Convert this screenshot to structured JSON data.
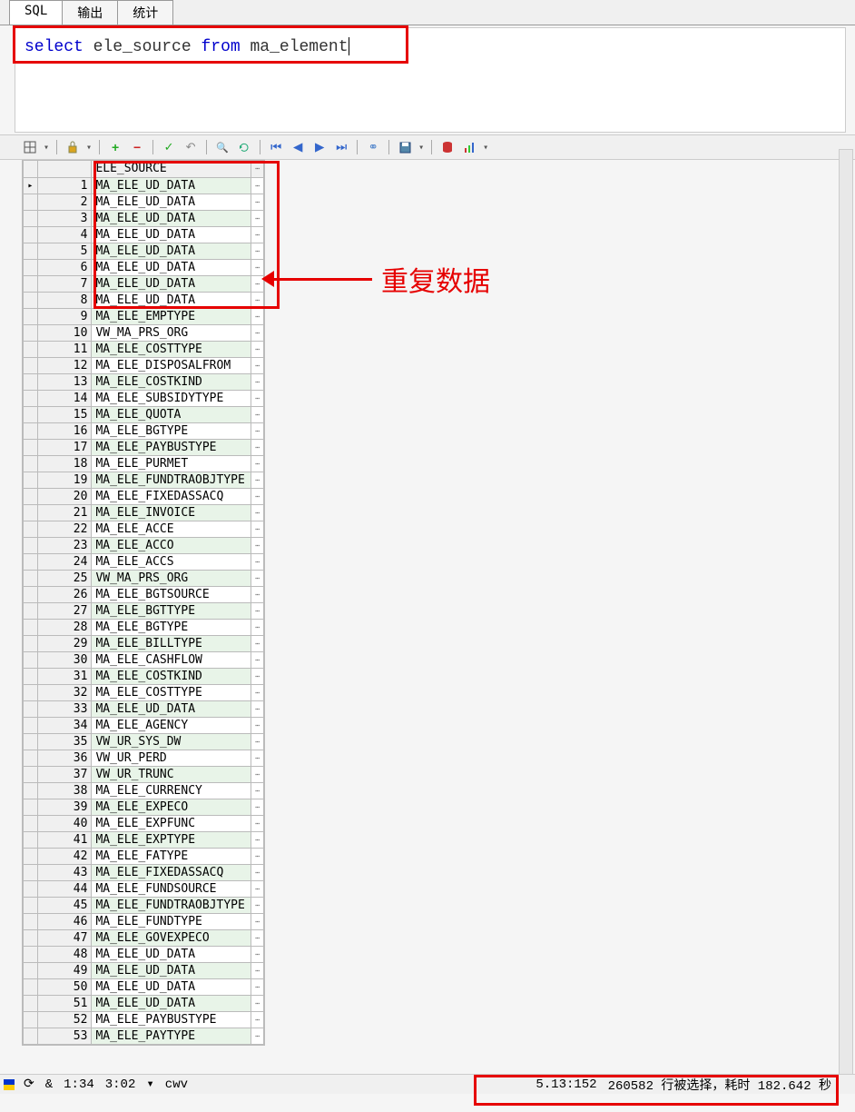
{
  "tabs": {
    "sql": "SQL",
    "output": "输出",
    "stats": "统计"
  },
  "sql": {
    "select": "select",
    "col": "ele_source",
    "from": "from",
    "table": "ma_element"
  },
  "column_header": "ELE_SOURCE",
  "rows": [
    {
      "n": 1,
      "v": "MA_ELE_UD_DATA"
    },
    {
      "n": 2,
      "v": "MA_ELE_UD_DATA"
    },
    {
      "n": 3,
      "v": "MA_ELE_UD_DATA"
    },
    {
      "n": 4,
      "v": "MA_ELE_UD_DATA"
    },
    {
      "n": 5,
      "v": "MA_ELE_UD_DATA"
    },
    {
      "n": 6,
      "v": "MA_ELE_UD_DATA"
    },
    {
      "n": 7,
      "v": "MA_ELE_UD_DATA"
    },
    {
      "n": 8,
      "v": "MA_ELE_UD_DATA"
    },
    {
      "n": 9,
      "v": "MA_ELE_EMPTYPE"
    },
    {
      "n": 10,
      "v": "VW_MA_PRS_ORG"
    },
    {
      "n": 11,
      "v": "MA_ELE_COSTTYPE"
    },
    {
      "n": 12,
      "v": "MA_ELE_DISPOSALFROM"
    },
    {
      "n": 13,
      "v": "MA_ELE_COSTKIND"
    },
    {
      "n": 14,
      "v": "MA_ELE_SUBSIDYTYPE"
    },
    {
      "n": 15,
      "v": "MA_ELE_QUOTA"
    },
    {
      "n": 16,
      "v": "MA_ELE_BGTYPE"
    },
    {
      "n": 17,
      "v": "MA_ELE_PAYBUSTYPE"
    },
    {
      "n": 18,
      "v": "MA_ELE_PURMET"
    },
    {
      "n": 19,
      "v": "MA_ELE_FUNDTRAOBJTYPE"
    },
    {
      "n": 20,
      "v": "MA_ELE_FIXEDASSACQ"
    },
    {
      "n": 21,
      "v": "MA_ELE_INVOICE"
    },
    {
      "n": 22,
      "v": "MA_ELE_ACCE"
    },
    {
      "n": 23,
      "v": "MA_ELE_ACCO"
    },
    {
      "n": 24,
      "v": "MA_ELE_ACCS"
    },
    {
      "n": 25,
      "v": "VW_MA_PRS_ORG"
    },
    {
      "n": 26,
      "v": "MA_ELE_BGTSOURCE"
    },
    {
      "n": 27,
      "v": "MA_ELE_BGTTYPE"
    },
    {
      "n": 28,
      "v": "MA_ELE_BGTYPE"
    },
    {
      "n": 29,
      "v": "MA_ELE_BILLTYPE"
    },
    {
      "n": 30,
      "v": "MA_ELE_CASHFLOW"
    },
    {
      "n": 31,
      "v": "MA_ELE_COSTKIND"
    },
    {
      "n": 32,
      "v": "MA_ELE_COSTTYPE"
    },
    {
      "n": 33,
      "v": "MA_ELE_UD_DATA"
    },
    {
      "n": 34,
      "v": "MA_ELE_AGENCY"
    },
    {
      "n": 35,
      "v": "VW_UR_SYS_DW"
    },
    {
      "n": 36,
      "v": "VW_UR_PERD"
    },
    {
      "n": 37,
      "v": "VW_UR_TRUNC"
    },
    {
      "n": 38,
      "v": "MA_ELE_CURRENCY"
    },
    {
      "n": 39,
      "v": "MA_ELE_EXPECO"
    },
    {
      "n": 40,
      "v": "MA_ELE_EXPFUNC"
    },
    {
      "n": 41,
      "v": "MA_ELE_EXPTYPE"
    },
    {
      "n": 42,
      "v": "MA_ELE_FATYPE"
    },
    {
      "n": 43,
      "v": "MA_ELE_FIXEDASSACQ"
    },
    {
      "n": 44,
      "v": "MA_ELE_FUNDSOURCE"
    },
    {
      "n": 45,
      "v": "MA_ELE_FUNDTRAOBJTYPE"
    },
    {
      "n": 46,
      "v": "MA_ELE_FUNDTYPE"
    },
    {
      "n": 47,
      "v": "MA_ELE_GOVEXPECO"
    },
    {
      "n": 48,
      "v": "MA_ELE_UD_DATA"
    },
    {
      "n": 49,
      "v": "MA_ELE_UD_DATA"
    },
    {
      "n": 50,
      "v": "MA_ELE_UD_DATA"
    },
    {
      "n": 51,
      "v": "MA_ELE_UD_DATA"
    },
    {
      "n": 52,
      "v": "MA_ELE_PAYBUSTYPE"
    },
    {
      "n": 53,
      "v": "MA_ELE_PAYTYPE"
    }
  ],
  "annotation": "重复数据",
  "status": {
    "lincol1": "1:34",
    "lincol2": "3:02",
    "conn_prefix": "cwv",
    "ip_frag": "5.13:152",
    "rows_selected": "260582 行被选择，耗时 182.642 秒"
  }
}
